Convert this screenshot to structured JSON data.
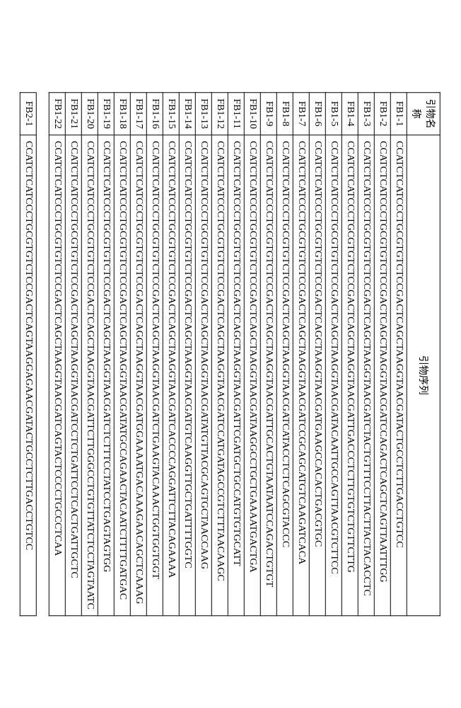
{
  "table": {
    "header_name": "引物名\n称",
    "header_seq": "引物序列",
    "rows": [
      {
        "name": "FB1-1",
        "seq": "CCATCTCATCCCTGCGTGTCTCCGACTCAGCTAAGGTAACGATACTGCCTCTTGACCTGTCC"
      },
      {
        "name": "FB1-2",
        "seq": "CCATCTCATCCCTGCGTGTCTCCGACTCAGCTAAGGTAACGATCCAGACTCAGCTCAGTTAATTTGG"
      },
      {
        "name": "FB1-3",
        "seq": "CCATCTCATCCCTGCGTGTCTCCGACTCAGCTAAGGTAACGATCTACTGTTTCCTTACTTACTACACCTC"
      },
      {
        "name": "FB1-4",
        "seq": "CCATCTCATCCCTGCGTGTCTCCGACTCAGCTAAGGTAACGATTGACCCTCTTGTGTCTGTTCTTG"
      },
      {
        "name": "FB1-5",
        "seq": "CCATCTCATCCCTGCGTGTCTCCGACTCAGCTAAGGTAACGATACAATTGCCAGTTAACGTCTTCC"
      },
      {
        "name": "FB1-6",
        "seq": "CCATCTCATCCCTGCGTGTCTCCGACTCAGCTAAGGTAACGATGAAGCCACACTGACGTGC"
      },
      {
        "name": "FB1-7",
        "seq": "CCATCTCATCCCTGCGTGTCTCCGACTCAGCTAAGGTAACGATCCGCAGCATGTCAAGATCACA"
      },
      {
        "name": "FB1-8",
        "seq": "CCATCTCATCCCTGCGTGTCTCCGACTCAGCTAAGGTAACGATCATACCTCTCAGCGTACCC"
      },
      {
        "name": "FB1-9",
        "seq": "CCATCTCATCCCTGCGTGTCTCCGACTCAGCTAAGGTAACGATTGCACTGTAATAATCCAGACTGTGT"
      },
      {
        "name": "FB1-10",
        "seq": "CCATCTCATCCCTGCGTGTCTCCGACTCAGCTAAGGTAACGATAAGGCCTGCTGAAAATGACTGA"
      },
      {
        "name": "FB1-11",
        "seq": "CCATCTCATCCCTGCGTGTCTCCGACTCAGCTAAGGTAACGATTCGATGCTGCCATGTGTGCATT"
      },
      {
        "name": "FB1-12",
        "seq": "CCATCTCATCCCTGCGTGTCTCCGACTCAGCTAAGGTAACGATCCATGATAGCCGTCTTTAACAAGC"
      },
      {
        "name": "FB1-13",
        "seq": "CCATCTCATCCCTGCGTGTCTCCGACTCAGCTAAGGTAACGATATGTTACGCAGTGCTAACCAAG"
      },
      {
        "name": "FB1-14",
        "seq": "CCATCTCATCCCTGCGTGTCTCCGACTCAGCTAAGGTAACGATGTCAAGGTTGCTGATTTTGGTC"
      },
      {
        "name": "FB1-15",
        "seq": "CCATCTCATCCCTGCGTGTCTCCGACTCAGCTAAGGTAACGATCACCCCAGGATTCTTACAGAAAA"
      },
      {
        "name": "FB1-16",
        "seq": "CCATCTCATCCCTGCGTGTCTCCGACTCAGCTAAGGTAACGATCTGAAGTACAAACTGGTGGTGGT"
      },
      {
        "name": "FB1-17",
        "seq": "CCATCTCATCCCTGCGTGTCTCCGACTCAGCTAAGGTAACGATGGAAAATGACAAAGAACAGCTCAAAG"
      },
      {
        "name": "FB1-18",
        "seq": "CCATCTCATCCCTGCGTGTCTCCGACTCAGCTAAGGTAACGATATGCCAGAACTACAATCTTTTGATGAC"
      },
      {
        "name": "FB1-19",
        "seq": "CCATCTCATCCCTGCGTGTCTCCGACTCAGCTAAGGTAACGATCTCTTTCCTATCCTGAGTAGTGG"
      },
      {
        "name": "FB1-20",
        "seq": "CCATCTCATCCCTGCGTGTCTCCGACTCAGCTAAGGTAACGATTCTTGGGCCTGTGTTATCTCCTAGTAATC"
      },
      {
        "name": "FB1-21",
        "seq": "CCATCTCATCCCTGCGTGTCTCCGACTCAGCTAAGGTAACGATCCTCTGATTCCTCACTGATTGCTC"
      },
      {
        "name": "FB1-22",
        "seq": "CCATCTCATCCCTGCGTGTCTCCGACTCAGCTAAGGTAACGATCAGTACTCCCCTGCCCTCAA"
      }
    ],
    "footer_row": {
      "name": "FB2-1",
      "seq": "CCATCTCATCCCTGCGTGTCTCCGACTCAGTAAGGAGAACGATACTGCCTCTTGACCTGTCC"
    }
  }
}
